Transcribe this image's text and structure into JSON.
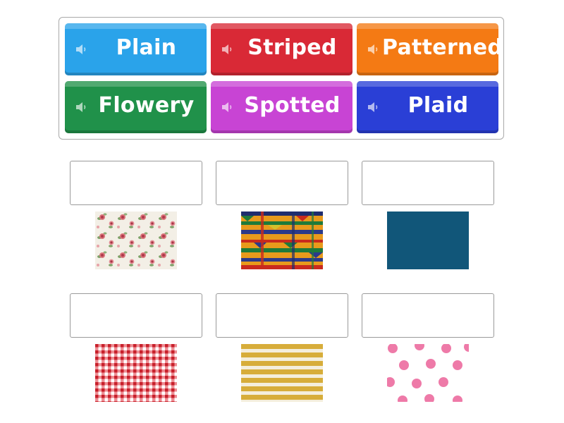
{
  "word_bank": {
    "tiles": [
      {
        "label": "Plain",
        "color": "#2aa3ea",
        "icon": "speaker-icon"
      },
      {
        "label": "Striped",
        "color": "#d92936",
        "icon": "speaker-icon"
      },
      {
        "label": "Patterned",
        "color": "#f47a14",
        "icon": "speaker-icon"
      },
      {
        "label": "Flowery",
        "color": "#20914a",
        "icon": "speaker-icon"
      },
      {
        "label": "Spotted",
        "color": "#c844d4",
        "icon": "speaker-icon"
      },
      {
        "label": "Plaid",
        "color": "#2a3fd6",
        "icon": "speaker-icon"
      }
    ]
  },
  "targets": [
    {
      "answer_value": "",
      "image": "floral-fabric"
    },
    {
      "answer_value": "",
      "image": "kente-patterned-fabric"
    },
    {
      "answer_value": "",
      "image": "plain-blue-fabric"
    },
    {
      "answer_value": "",
      "image": "red-gingham-plaid-fabric"
    },
    {
      "answer_value": "",
      "image": "yellow-striped-fabric"
    },
    {
      "answer_value": "",
      "image": "pink-polka-dot-fabric"
    }
  ]
}
